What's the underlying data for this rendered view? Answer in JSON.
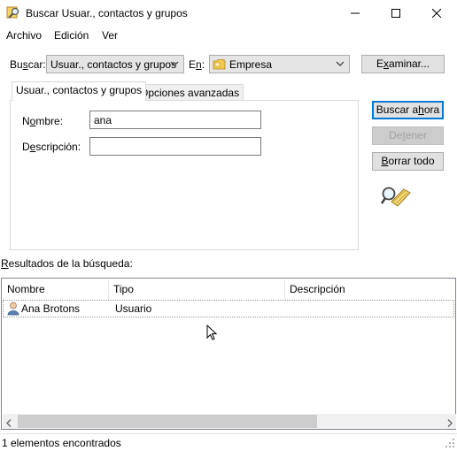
{
  "window": {
    "title": "Buscar Usuar., contactos y grupos"
  },
  "menu": {
    "items": [
      "Archivo",
      "Edición",
      "Ver"
    ]
  },
  "search": {
    "buscar_label_pre": "Bu",
    "buscar_label_u": "s",
    "buscar_label_post": "car:",
    "buscar_value": "Usuar., contactos y grupos",
    "en_label_pre": "E",
    "en_label_u": "n",
    "en_label_post": ":",
    "en_value": "Empresa",
    "examinar_label_pre": "E",
    "examinar_label_u": "x",
    "examinar_label_post": "aminar..."
  },
  "tabs": [
    {
      "label": "Usuar., contactos y grupos"
    },
    {
      "label": "Opciones avanzadas"
    }
  ],
  "form": {
    "nombre_label_pre": "N",
    "nombre_label_u": "o",
    "nombre_label_post": "mbre:",
    "nombre_value": "ana",
    "descripcion_label_pre": "D",
    "descripcion_label_u": "e",
    "descripcion_label_post": "scripción:",
    "descripcion_value": ""
  },
  "actions": {
    "buscar_ahora_pre": "Buscar a",
    "buscar_ahora_u": "h",
    "buscar_ahora_post": "ora",
    "detener_pre": "De",
    "detener_u": "t",
    "detener_post": "ener",
    "borrar_todo_pre": "",
    "borrar_todo_u": "B",
    "borrar_todo_post": "orrar todo"
  },
  "results": {
    "label_pre": "",
    "label_u": "R",
    "label_post": "esultados de la búsqueda:",
    "columns": [
      "Nombre",
      "Tipo",
      "Descripción"
    ],
    "rows": [
      {
        "nombre": "Ana Brotons",
        "tipo": "Usuario",
        "descripcion": ""
      }
    ]
  },
  "status": {
    "text": "1 elementos encontrados"
  },
  "icons": {
    "app": "search-directory-icon",
    "folder": "folder-icon",
    "search_anim": "search-magnifier-icon",
    "user": "user-icon"
  }
}
